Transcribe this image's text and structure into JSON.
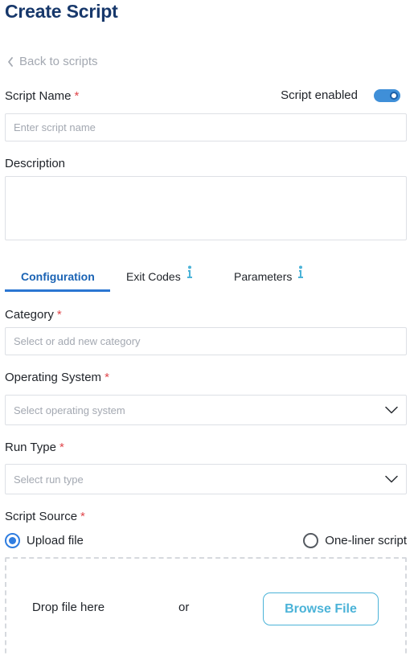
{
  "page": {
    "title": "Create Script"
  },
  "back_link": {
    "label": "Back to scripts"
  },
  "script_name": {
    "label": "Script Name",
    "required_mark": "*",
    "placeholder": "Enter script name",
    "value": ""
  },
  "enabled_toggle": {
    "label": "Script enabled",
    "on": true
  },
  "description": {
    "label": "Description",
    "value": ""
  },
  "tabs": [
    {
      "label": "Configuration",
      "active": true
    },
    {
      "label": "Exit Codes",
      "active": false,
      "icon": "info-icon"
    },
    {
      "label": "Parameters",
      "active": false,
      "icon": "info-icon"
    }
  ],
  "category": {
    "label": "Category",
    "required_mark": "*",
    "placeholder": "Select or add new category"
  },
  "operating_system": {
    "label": "Operating System",
    "required_mark": "*",
    "placeholder": "Select operating system"
  },
  "run_type": {
    "label": "Run Type",
    "required_mark": "*",
    "placeholder": "Select run type"
  },
  "script_source": {
    "label": "Script Source",
    "required_mark": "*",
    "options": [
      {
        "label": "Upload file",
        "selected": true
      },
      {
        "label": "One-liner script",
        "selected": false
      }
    ]
  },
  "dropzone": {
    "drop_text": "Drop file here",
    "or_text": "or",
    "browse_label": "Browse File"
  },
  "colors": {
    "title": "#17386b",
    "accent": "#2b76d2",
    "required": "#e0464b",
    "browse": "#4bb3d8",
    "placeholder": "#a3a8b1"
  }
}
